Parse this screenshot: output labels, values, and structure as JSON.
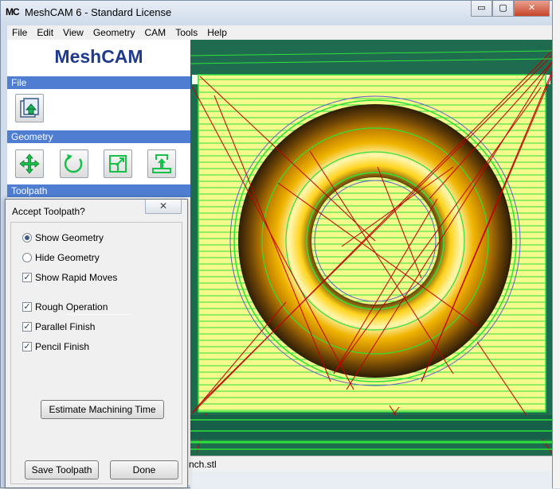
{
  "window": {
    "app_icon": "MC",
    "title": "MeshCAM 6 - Standard License",
    "controls": {
      "minimize": "▭",
      "maximize": "▢",
      "close": "✕"
    }
  },
  "menu": [
    "File",
    "Edit",
    "View",
    "Geometry",
    "CAM",
    "Tools",
    "Help"
  ],
  "left_panel": {
    "brand": "MeshCAM",
    "sections": {
      "file": "File",
      "geometry": "Geometry",
      "toolpath": "Toolpath"
    },
    "icons": {
      "open": "open-file-icon",
      "move": "move-icon",
      "rotate": "rotate-icon",
      "scale": "scale-icon",
      "set_base": "set-base-icon"
    }
  },
  "dialog": {
    "title": "Accept Toolpath?",
    "close_label": "✕",
    "geometry_options": [
      {
        "label": "Show Geometry",
        "selected": true
      },
      {
        "label": "Hide Geometry",
        "selected": false
      }
    ],
    "show_rapid": {
      "label": "Show Rapid Moves",
      "checked": true
    },
    "operations": [
      {
        "label": "Rough Operation",
        "checked": true
      },
      {
        "label": "Parallel Finish",
        "checked": true
      },
      {
        "label": "Pencil Finish",
        "checked": true
      }
    ],
    "estimate_button": "Estimate Machining Time",
    "save_button": "Save Toolpath",
    "done_button": "Done"
  },
  "status": {
    "filename_partial": "nch.stl"
  },
  "colors": {
    "section_header": "#4f7dd1",
    "brand": "#1f3a8c",
    "toolpath_green": "#2ee03a",
    "rapid_red": "#c00000",
    "stock_yellow": "#f3f98a"
  }
}
